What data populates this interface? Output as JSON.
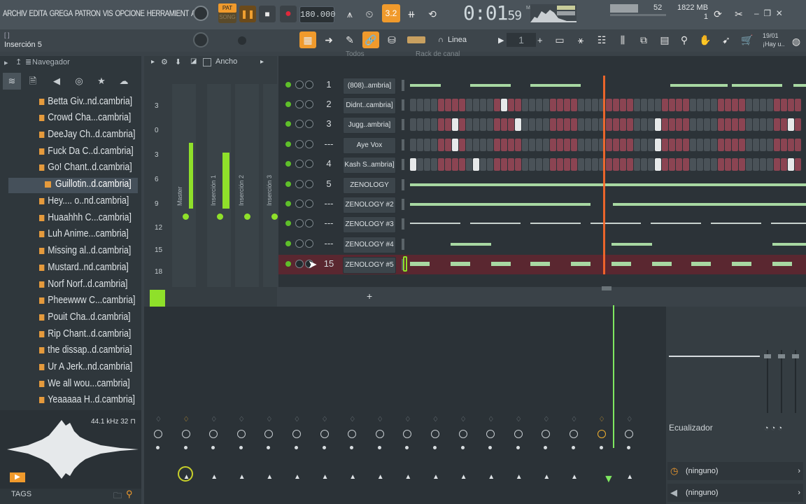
{
  "menu": {
    "items": [
      "ARCHIV",
      "EDITA",
      "GREGA",
      "PATRON",
      "VIS",
      "OPCIONE",
      "HERRAMIENT",
      "A"
    ]
  },
  "transport": {
    "pat_label": "PAT",
    "song_label": "SONG",
    "tempo": "180.000",
    "time": "0:01",
    "time_small": "59",
    "time_unit": "M:S:CS",
    "cpu": "52",
    "memory": "1822 MB",
    "memory_sub": "1"
  },
  "second_row": {
    "brackets": "[ ]",
    "insertion": "Inserción 5",
    "snap_label": "Linea",
    "pattern_number": "1",
    "hint_date": "19/01",
    "hint_text": "¡Hay u.."
  },
  "browser": {
    "header": "Navegador",
    "items": [
      "Betta Giv..nd.cambria]",
      "Crowd Cha...cambria]",
      "DeeJay Ch..d.cambria]",
      "Fuck Da C..d.cambria]",
      "Go! Chant..d.cambria]",
      "Guillotin..d.cambria]",
      "Hey.... o..nd.cambria]",
      "Huaahhh C...cambria]",
      "Luh Anime...cambria]",
      "Missing al..d.cambria]",
      "Mustard..nd.cambria]",
      "Norf Norf..d.cambria]",
      "Pheewww C...cambria]",
      "Pouit Cha..d.cambria]",
      "Rip Chant..d.cambria]",
      "the dissap..d.cambria]",
      "Ur A Jerk..nd.cambria]",
      "We all wou...cambria]",
      "Yeaaaaa H..d.cambria]"
    ],
    "selected_index": 5,
    "sample_rate": "44.1 kHz 32",
    "tags": "TAGS"
  },
  "mixer_top": {
    "width_label": "Ancho",
    "strips": [
      "Master",
      "Inserción 1",
      "Inserción 2",
      "Inserción 3"
    ],
    "db_ticks": [
      "3",
      "0",
      "3",
      "6",
      "9",
      "12",
      "15",
      "18"
    ]
  },
  "rack": {
    "header_left": "Todos",
    "header_title": "Rack de canal",
    "channels": [
      {
        "num": "1",
        "name": "(808)..ambria]"
      },
      {
        "num": "2",
        "name": "Didnt..cambria]"
      },
      {
        "num": "3",
        "name": "Jugg..ambria]"
      },
      {
        "num": "---",
        "name": "Aye Vox"
      },
      {
        "num": "4",
        "name": "Kash S..ambria]"
      },
      {
        "num": "5",
        "name": "ZENOLOGY"
      },
      {
        "num": "---",
        "name": "ZENOLOGY #2"
      },
      {
        "num": "---",
        "name": "ZENOLOGY #3"
      },
      {
        "num": "---",
        "name": "ZENOLOGY #4"
      },
      {
        "num": "15",
        "name": "ZENOLOGY #5"
      }
    ]
  },
  "right_panel": {
    "eq_label": "Ecualizador",
    "slot1": "(ninguno)",
    "slot2": "(ninguno)"
  },
  "colors": {
    "accent_orange": "#f09a2c",
    "led_green": "#5fbf2a",
    "note_green": "#a8d8a2",
    "step_red": "#8b4452",
    "playhead": "#ff6a2a"
  }
}
